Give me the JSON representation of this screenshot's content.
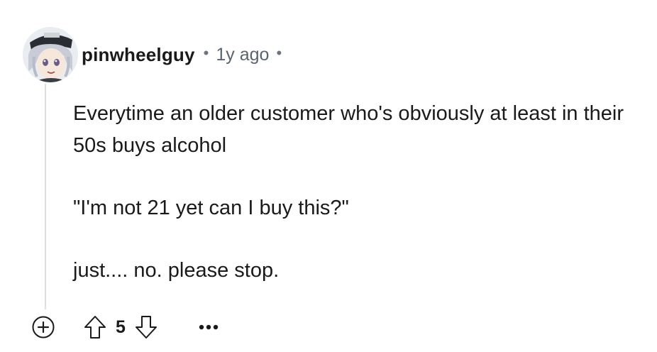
{
  "comment": {
    "author": "pinwheelguy",
    "separator": "•",
    "timestamp": "1y ago",
    "paragraphs": [
      "Everytime an older customer who's obviously at least in their 50s buys alcohol",
      "\"I'm not 21 yet can I buy this?\"",
      "just.... no. please stop."
    ],
    "score": "5"
  },
  "icons": {
    "expand": "plus-circle-icon",
    "upvote": "arrow-up-outline-icon",
    "downvote": "arrow-down-outline-icon",
    "more": "ellipsis-icon"
  },
  "colors": {
    "text": "#1a1a1b",
    "meta": "#5a6470",
    "thread_line": "#dcdfe2"
  }
}
